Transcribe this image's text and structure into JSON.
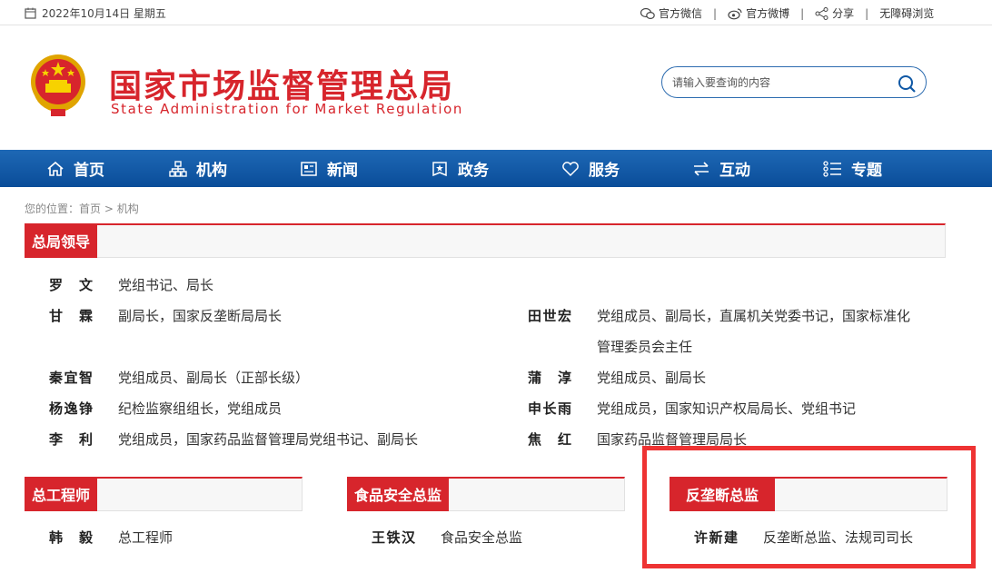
{
  "topbar": {
    "date": "2022年10月14日 星期五",
    "wechat": "官方微信",
    "weibo": "官方微博",
    "share": "分享",
    "accessible": "无障碍浏览",
    "separator": "|"
  },
  "header": {
    "title_cn": "国家市场监督管理总局",
    "title_en": "State Administration for Market Regulation",
    "search_placeholder": "请输入要查询的内容"
  },
  "nav": [
    {
      "label": "首页",
      "icon": "home-icon"
    },
    {
      "label": "机构",
      "icon": "org-chart-icon"
    },
    {
      "label": "新闻",
      "icon": "news-icon"
    },
    {
      "label": "政务",
      "icon": "government-icon"
    },
    {
      "label": "服务",
      "icon": "heart-icon"
    },
    {
      "label": "互动",
      "icon": "exchange-icon"
    },
    {
      "label": "专题",
      "icon": "topics-icon"
    }
  ],
  "breadcrumb": {
    "prefix": "您的位置：",
    "home": "首页",
    "separator": " > ",
    "current": "机构"
  },
  "leaders": {
    "title": "总局领导",
    "rows": [
      {
        "name": "罗  文",
        "duty": "党组书记、局长"
      },
      {
        "name": "甘  霖",
        "duty": "副局长，国家反垄断局局长"
      },
      {
        "name": "田世宏",
        "duty": "党组成员、副局长，直属机关党委书记，国家标准化",
        "duty2": "管理委员会主任"
      },
      {
        "name": "秦宜智",
        "duty": "党组成员、副局长（正部长级）"
      },
      {
        "name": "蒲  淳",
        "duty": "党组成员、副局长"
      },
      {
        "name": "杨逸铮",
        "duty": "纪检监察组组长，党组成员"
      },
      {
        "name": "申长雨",
        "duty": "党组成员，国家知识产权局局长、党组书记"
      },
      {
        "name": "李  利",
        "duty": "党组成员，国家药品监督管理局党组书记、副局长"
      },
      {
        "name": "焦  红",
        "duty": "国家药品监督管理局局长"
      }
    ]
  },
  "chief_engineer": {
    "title": "总工程师",
    "name": "韩  毅",
    "duty": "总工程师"
  },
  "food_safety": {
    "title": "食品安全总监",
    "name": "王铁汉",
    "duty": "食品安全总监"
  },
  "antitrust": {
    "title": "反垄断总监",
    "name": "许新建",
    "duty": "反垄断总监、法规司司长"
  },
  "colors": {
    "brand_red": "#d7252c",
    "nav_blue": "#0f58a5",
    "highlight": "#ee3333"
  }
}
